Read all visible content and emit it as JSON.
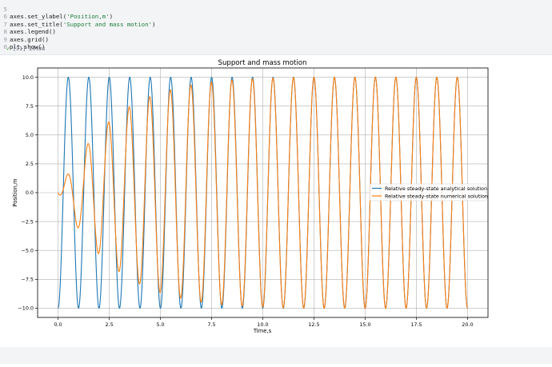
{
  "code_lines": [
    {
      "n": "5",
      "pre": "axes.set_ylabel(",
      "str": "'Position,m'",
      "post": ")"
    },
    {
      "n": "6",
      "pre": "axes.set_title(",
      "str": "'Support and mass motion'",
      "post": ")"
    },
    {
      "n": "7",
      "pre": "axes.legend()",
      "str": "",
      "post": ""
    },
    {
      "n": "8",
      "pre": "axes.grid()",
      "str": "",
      "post": ""
    },
    {
      "n": "9",
      "pre": "plt.show()",
      "str": "",
      "post": ""
    },
    {
      "n": "0",
      "pre": "",
      "str": "",
      "post": ""
    }
  ],
  "cell_status": {
    "exec_count": "[31]",
    "duration": "209ms",
    "icon": "check-icon"
  },
  "colors": {
    "analytical": "#1f77b4",
    "numerical": "#ff7f0e",
    "status_ok": "#3a9a3a"
  },
  "chart_data": {
    "type": "line",
    "title": "Support and mass motion",
    "xlabel": "Time,s",
    "ylabel": "Position,m",
    "xlim": [
      -1.0,
      21.0
    ],
    "ylim": [
      -10.8,
      10.8
    ],
    "xticks": [
      "0.0",
      "2.5",
      "5.0",
      "7.5",
      "10.0",
      "12.5",
      "15.0",
      "17.5",
      "20.0"
    ],
    "xtick_values": [
      0,
      2.5,
      5,
      7.5,
      10,
      12.5,
      15,
      17.5,
      20
    ],
    "yticks": [
      "10.0",
      "7.5",
      "5.0",
      "2.5",
      "0.0",
      "−2.5",
      "−5.0",
      "−7.5",
      "−10.0"
    ],
    "ytick_values": [
      10,
      7.5,
      5,
      2.5,
      0,
      -2.5,
      -5,
      -7.5,
      -10
    ],
    "grid": true,
    "legend_position": "center-right",
    "series": [
      {
        "name": "Relative steady-state analytical solution",
        "color": "#1f77b4",
        "form": "y = -10 cos(2π t)",
        "amplitude": 10,
        "frequency_hz": 1.0,
        "x_range": [
          0,
          20
        ]
      },
      {
        "name": "Relative steady-state numerical solution",
        "color": "#ff7f0e",
        "form": "y = -10 cos(2π t) + 10 e^(-0.35 t) cos(2π ·0.98 t)",
        "amplitude": 10,
        "frequency_hz": 1.0,
        "transient_decay": 0.35,
        "x_range": [
          0,
          20
        ]
      }
    ]
  }
}
